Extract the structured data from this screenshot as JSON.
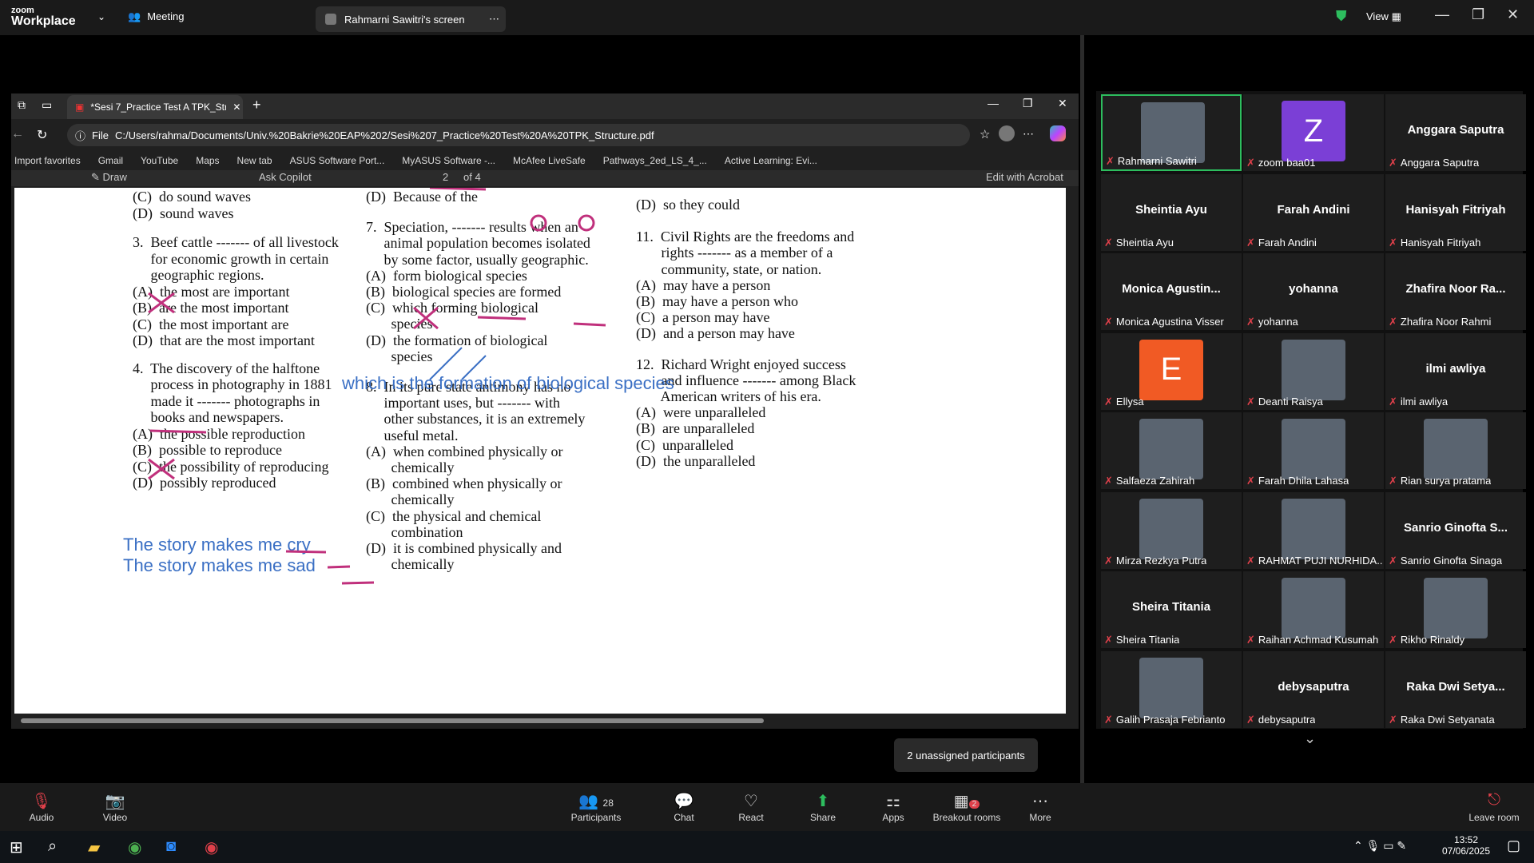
{
  "zoom": {
    "logo_top": "zoom",
    "logo_bottom": "Workplace",
    "meeting_label": "Meeting",
    "share_label": "Rahmarni Sawitri's screen",
    "view_label": "View"
  },
  "browser": {
    "tab_title": "*Sesi 7_Practice Test A TPK_Struct",
    "address": "C:/Users/rahma/Documents/Univ.%20Bakrie%20EAP%202/Sesi%207_Practice%20Test%20A%20TPK_Structure.pdf",
    "file_label": "File",
    "favorites": [
      "Import favorites",
      "Gmail",
      "YouTube",
      "Maps",
      "New tab",
      "ASUS Software Port...",
      "MyASUS Software -...",
      "McAfee LiveSafe",
      "Pathways_2ed_LS_4_...",
      "Active Learning: Evi..."
    ],
    "pdf_toolbar": {
      "draw": "Draw",
      "copilot": "Ask Copilot",
      "page": "2",
      "of": "of 4",
      "acrobat": "Edit with Acrobat"
    }
  },
  "pdf": {
    "col1": [
      "(C)  do sound waves",
      "(D)  sound waves",
      "3.  Beef cattle ------- of all livestock",
      "     for economic growth in certain",
      "     geographic regions.",
      "(A)  the most are important",
      "(B)  are the most important",
      "(C)  the most important are",
      "(D)  that are the most important",
      "4.  The discovery of the halftone",
      "     process in photography in 1881",
      "     made it ------- photographs in",
      "     books and newspapers.",
      "(A)  the possible reproduction",
      "(B)  possible to reproduce",
      "(C)  the possibility of reproducing",
      "(D)  possibly reproduced"
    ],
    "col2": [
      "(D)  Because of the",
      "7.  Speciation, ------- results when an",
      "     animal population becomes isolated",
      "     by some factor, usually geographic.",
      "(A)  form biological species",
      "(B)  biological species are formed",
      "(C)  which forming biological",
      "       species",
      "(D)  the formation of biological",
      "       species",
      "8.  In its pure state antimony has no",
      "     important uses, but ------- with",
      "     other substances, it is an extremely",
      "     useful metal.",
      "(A)  when combined physically or",
      "       chemically",
      "(B)  combined when physically or",
      "       chemically",
      "(C)  the physical and chemical",
      "       combination",
      "(D)  it is combined physically and",
      "       chemically"
    ],
    "col3": [
      "(D)  so they could",
      "11.  Civil Rights are the freedoms and",
      "       rights ------- as a member of a",
      "       community, state, or nation.",
      "(A)  may have a person",
      "(B)  may have a person who",
      "(C)  a person may have",
      "(D)  and a person may have",
      "12.  Richard Wright enjoyed success",
      "       and influence ------- among Black",
      "       American writers of his era.",
      "(A)  were unparalleled",
      "(B)  are unparalleled",
      "(C)  unparalleled",
      "(D)  the unparalleled"
    ],
    "hand1": "which is the formation of biological species",
    "hand2": "The story makes me cry",
    "hand3": "The story makes me sad"
  },
  "participants": [
    {
      "name": "Rahmarni Sawitri",
      "type": "photo"
    },
    {
      "name": "zoom baa01",
      "type": "letter",
      "letter": "Z",
      "color": "#7b3fd6"
    },
    {
      "name": "Anggara Saputra",
      "type": "text"
    },
    {
      "name": "Sheintia Ayu",
      "type": "text"
    },
    {
      "name": "Farah Andini",
      "type": "text"
    },
    {
      "name": "Hanisyah Fitriyah",
      "type": "text"
    },
    {
      "name": "Monica Agustina Visser",
      "big": "Monica  Agustin...",
      "type": "text"
    },
    {
      "name": "yohanna",
      "type": "text"
    },
    {
      "name": "Zhafira Noor Rahmi",
      "big": "Zhafira Noor Ra...",
      "type": "text"
    },
    {
      "name": "Ellysa",
      "type": "letter",
      "letter": "E",
      "color": "#f15a24"
    },
    {
      "name": "Deanti Raisya",
      "type": "photo"
    },
    {
      "name": "ilmi awliya",
      "type": "text"
    },
    {
      "name": "Salfaeza Zahirah",
      "type": "photo"
    },
    {
      "name": "Farah Dhila Lahasa",
      "type": "photo"
    },
    {
      "name": "Rian surya pratama",
      "type": "photo"
    },
    {
      "name": "Mirza Rezkya Putra",
      "type": "photo"
    },
    {
      "name": "RAHMAT PUJI NURHIDA...",
      "type": "photo"
    },
    {
      "name": "Sanrio Ginofta Sinaga",
      "big": "Sanrio Ginofta S...",
      "type": "text"
    },
    {
      "name": "Sheira Titania",
      "type": "text"
    },
    {
      "name": "Raihan Achmad Kusumah",
      "type": "photo"
    },
    {
      "name": "Rikho Rinaldy",
      "type": "photo"
    },
    {
      "name": "Galih Prasaja Febrianto",
      "type": "photo"
    },
    {
      "name": "debysaputra",
      "type": "text"
    },
    {
      "name": "Raka Dwi Setyanata",
      "big": "Raka Dwi Setya...",
      "type": "text"
    }
  ],
  "toast": "2 unassigned participants",
  "toolbar": {
    "audio": "Audio",
    "video": "Video",
    "participants": "Participants",
    "count": "28",
    "chat": "Chat",
    "react": "React",
    "share": "Share",
    "apps": "Apps",
    "breakout": "Breakout rooms",
    "breakout_badge": "2",
    "more": "More",
    "leave": "Leave room"
  },
  "taskbar": {
    "time": "13:52",
    "date": "07/06/2025"
  }
}
